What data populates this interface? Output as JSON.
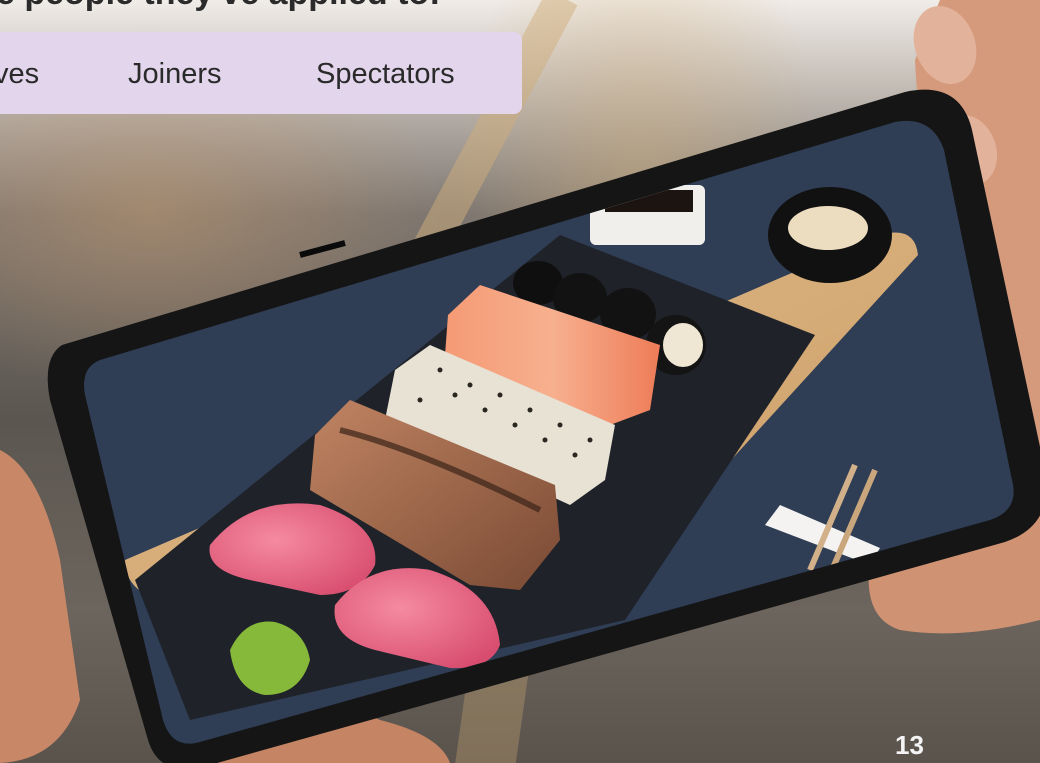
{
  "header": {
    "partial_sentence": "e people they've applied to:"
  },
  "tabs": [
    {
      "label": "ves"
    },
    {
      "label": "Joiners"
    },
    {
      "label": "Spectators"
    }
  ],
  "page_number": "13",
  "colors": {
    "tab_background": "#e2d5ec",
    "phone_body": "#151515",
    "tablecloth": "#2f3d55",
    "slate_board": "#1f2329",
    "bamboo_board": "#d9b07c"
  }
}
